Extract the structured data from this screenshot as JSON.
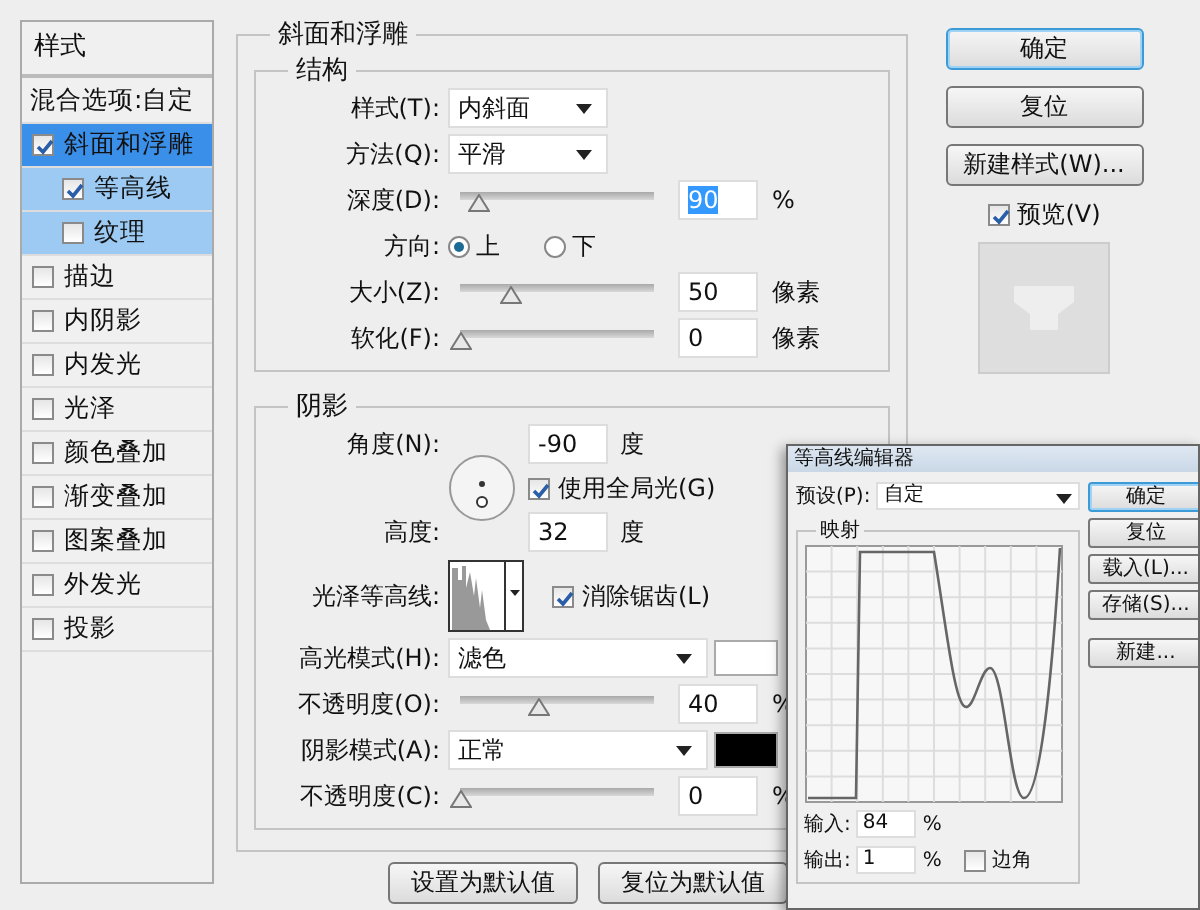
{
  "sidebar": {
    "header": "样式",
    "blend_options": "混合选项:自定",
    "items": [
      {
        "label": "斜面和浮雕",
        "checked": true,
        "selected": true,
        "children": [
          {
            "label": "等高线",
            "checked": true,
            "selected": false
          },
          {
            "label": "纹理",
            "checked": false,
            "selected": false
          }
        ]
      },
      {
        "label": "描边",
        "checked": false,
        "selected": false
      },
      {
        "label": "内阴影",
        "checked": false,
        "selected": false
      },
      {
        "label": "内发光",
        "checked": false,
        "selected": false
      },
      {
        "label": "光泽",
        "checked": false,
        "selected": false
      },
      {
        "label": "颜色叠加",
        "checked": false,
        "selected": false
      },
      {
        "label": "渐变叠加",
        "checked": false,
        "selected": false
      },
      {
        "label": "图案叠加",
        "checked": false,
        "selected": false
      },
      {
        "label": "外发光",
        "checked": false,
        "selected": false
      },
      {
        "label": "投影",
        "checked": false,
        "selected": false
      }
    ]
  },
  "bevel": {
    "title": "斜面和浮雕",
    "structure": {
      "title": "结构",
      "rows": [
        {
          "kind": "select",
          "label": "样式(T):",
          "value": "内斜面"
        },
        {
          "kind": "select",
          "label": "方法(Q):",
          "value": "平滑"
        },
        {
          "kind": "slider",
          "label": "深度(D):",
          "level": 0.09,
          "value": "90",
          "unit": "%",
          "text_selected": true
        },
        {
          "kind": "radio",
          "label": "方向:",
          "options": [
            {
              "label": "上",
              "selected": true
            },
            {
              "label": "下",
              "selected": false
            }
          ]
        },
        {
          "kind": "slider",
          "label": "大小(Z):",
          "level": 0.26,
          "value": "50",
          "unit": "像素",
          "text_selected": false
        },
        {
          "kind": "slider",
          "label": "软化(F):",
          "level": 0,
          "value": "0",
          "unit": "像素",
          "text_selected": false
        }
      ]
    },
    "shading": {
      "title": "阴影",
      "angle_label": "角度(N):",
      "angle": "-90",
      "angle_unit": "度",
      "global_light": {
        "label": "使用全局光(G)",
        "checked": true
      },
      "altitude_label": "高度:",
      "altitude": "32",
      "altitude_unit": "度",
      "gloss_label": "光泽等高线:",
      "anti_alias": {
        "label": "消除锯齿(L)",
        "checked": true
      },
      "rows": [
        {
          "kind": "mode",
          "label": "高光模式(H):",
          "value": "滤色",
          "color": "#ffffff"
        },
        {
          "kind": "slider",
          "label": "不透明度(O):",
          "level": 0.4,
          "value": "40",
          "unit": "%",
          "text_selected": false
        },
        {
          "kind": "mode",
          "label": "阴影模式(A):",
          "value": "正常",
          "color": "#000000"
        },
        {
          "kind": "slider",
          "label": "不透明度(C):",
          "level": 0,
          "value": "0",
          "unit": "%",
          "text_selected": false
        }
      ]
    },
    "buttons": [
      "设置为默认值",
      "复位为默认值"
    ]
  },
  "actions": {
    "buttons": [
      {
        "label": "确定",
        "default": true
      },
      {
        "label": "复位",
        "default": false
      },
      {
        "label": "新建样式(W)...",
        "default": false
      }
    ],
    "preview": {
      "label": "预览(V)",
      "checked": true
    }
  },
  "contour_editor": {
    "title": "等高线编辑器",
    "preset_label": "预设(P):",
    "preset": "自定",
    "mapping_title": "映射",
    "input_label": "输入:",
    "input": "84",
    "input_unit": "%",
    "output_label": "输出:",
    "output": "1",
    "output_unit": "%",
    "corner": {
      "label": "边角",
      "checked": false
    },
    "buttons": [
      {
        "label": "确定",
        "default": true
      },
      {
        "label": "复位",
        "default": false
      },
      {
        "label": "载入(L)...",
        "default": false
      },
      {
        "label": "存储(S)...",
        "default": false
      },
      {
        "label": "新建...",
        "default": false
      }
    ]
  }
}
